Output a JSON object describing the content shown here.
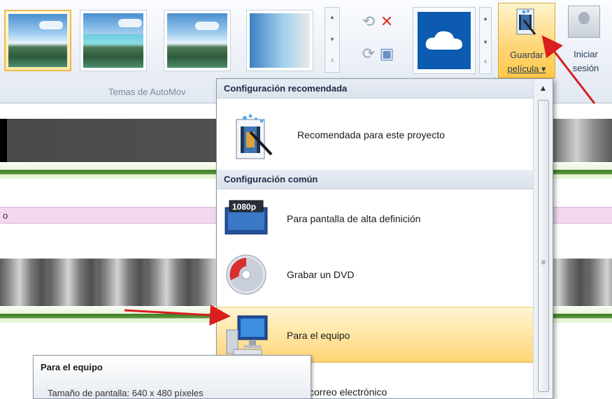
{
  "ribbon": {
    "themes_group_label": "Temas de AutoMov",
    "save_movie": {
      "line1": "Guardar",
      "line2": "película ▾"
    },
    "sign_in": {
      "line1": "Iniciar",
      "line2": "sesión"
    }
  },
  "timeline": {
    "caption_text": "o"
  },
  "menu": {
    "section_recommended": "Configuración recomendada",
    "section_common": "Configuración común",
    "items": [
      {
        "label": "Recomendada para este proyecto",
        "icon": "film-wand-icon"
      },
      {
        "label": "Para pantalla de alta definición",
        "icon": "hd-1080p-icon"
      },
      {
        "label": "Grabar un DVD",
        "icon": "dvd-icon"
      },
      {
        "label": "Para el equipo",
        "icon": "computer-icon"
      },
      {
        "label": "correo electrónico",
        "icon": "email-icon"
      }
    ],
    "hd_badge": "1080p"
  },
  "tooltip": {
    "title": "Para el equipo",
    "detail": "Tamaño de pantalla: 640 x 480 píxeles"
  },
  "colors": {
    "highlight": "#ffd475",
    "annotation_arrow": "#d91e1e",
    "skydrive_blue": "#0c5bb0"
  }
}
